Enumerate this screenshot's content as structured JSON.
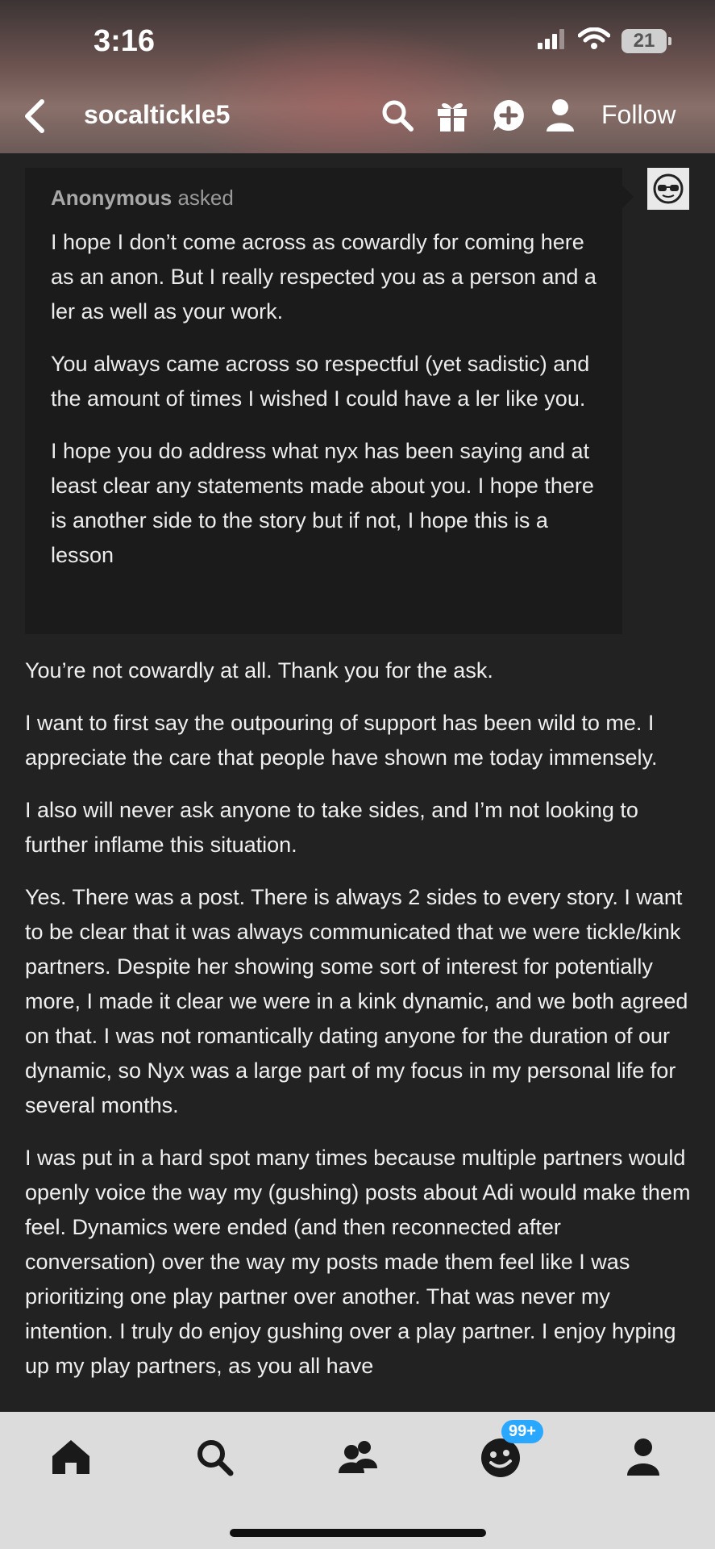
{
  "status_bar": {
    "time": "3:16",
    "battery": "21"
  },
  "header": {
    "blog_name": "socaltickle5",
    "follow_label": "Follow"
  },
  "ask": {
    "asker": "Anonymous",
    "asked_label": "asked",
    "paragraphs": [
      "I hope I don’t come across as cowardly for coming here as an anon. But I really respected you as a person and a ler as well as your work.",
      "You always came across so respectful (yet sadistic) and the amount of times I wished I could have a ler like you.",
      "I hope you do address what nyx has been saying and at least clear any statements made about you. I hope there is another side to the story but if not, I hope this is a lesson"
    ]
  },
  "answer": {
    "paragraphs": [
      "You’re not cowardly at all. Thank you for the ask.",
      "I want to first say the outpouring of support has been wild to me. I appreciate the care that people have shown me today immensely.",
      "I also will never ask anyone to take sides, and I’m not looking to further inflame this situation.",
      "Yes. There was a post. There is always 2 sides to every story. I want to be clear that it was always communicated that we were tickle/kink partners. Despite her showing some sort of interest for potentially more, I made it clear we were in a kink dynamic, and we both agreed on that. I was not romantically dating anyone for the duration of our dynamic, so Nyx was a large part of my focus in my personal life for several months.",
      "I was put in a hard spot many times because multiple partners would openly voice the way my (gushing) posts about Adi would make them feel. Dynamics were ended (and then reconnected after conversation) over the way my posts made them feel like I was prioritizing one play partner over another. That was never my intention. I truly do enjoy gushing over a play partner. I enjoy hyping up my play partners, as you all have"
    ]
  },
  "tabbar": {
    "notifications_badge": "99+"
  },
  "icons": {
    "back": "chevron-left-icon",
    "search": "search-icon",
    "gift": "gift-icon",
    "message": "message-plus-icon",
    "person": "person-icon",
    "home": "home-icon",
    "explore": "search-icon",
    "community": "people-icon",
    "activity": "smiley-activity-icon",
    "account": "account-icon"
  },
  "colors": {
    "background": "#222222",
    "ask_bg": "#1b1b1b",
    "tabbar_bg": "#dcdcdc",
    "badge": "#2aa8ff"
  }
}
